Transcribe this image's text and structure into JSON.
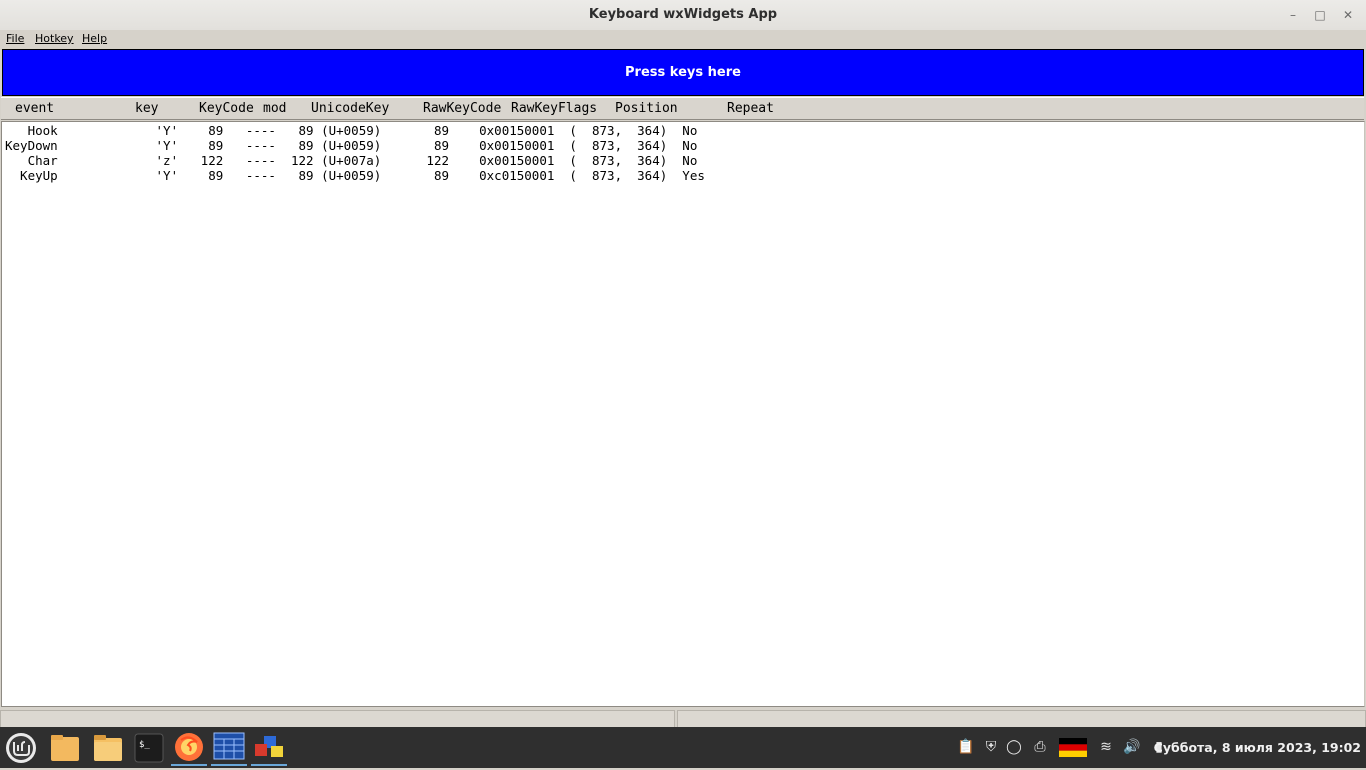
{
  "window": {
    "title": "Keyboard wxWidgets App"
  },
  "menu": {
    "items": [
      "File",
      "Hotkey",
      "Help"
    ]
  },
  "press_area": {
    "label": "Press keys here"
  },
  "columns": [
    "event",
    "key",
    "KeyCode",
    "mod",
    "UnicodeKey",
    "RawKeyCode",
    "RawKeyFlags",
    "Position",
    "Repeat"
  ],
  "log_lines": [
    "   Hook             'Y'    89   ----   89 (U+0059)       89    0x00150001  (  873,  364)  No",
    "KeyDown             'Y'    89   ----   89 (U+0059)       89    0x00150001  (  873,  364)  No",
    "   Char             'z'   122   ----  122 (U+007a)      122    0x00150001  (  873,  364)  No",
    "  KeyUp             'Y'    89   ----   89 (U+0059)       89    0xc0150001  (  873,  364)  Yes"
  ],
  "taskbar": {
    "apps": [
      "mint-menu-icon",
      "folder-icon",
      "files-icon",
      "terminal-icon",
      "firefox-icon",
      "wxwidgets-app-icon",
      "keyboard-app-icon"
    ],
    "clock": "Суббота, 8 июля 2023, 19:02"
  }
}
